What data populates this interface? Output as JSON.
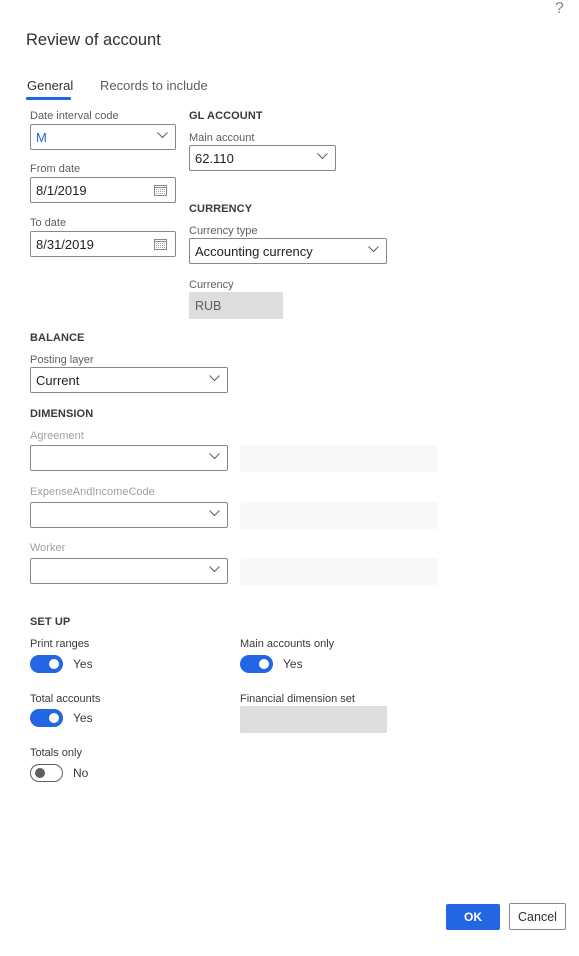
{
  "dialog": {
    "title": "Review of account",
    "help_icon": "question-mark-icon",
    "help_glyph": "?"
  },
  "tabs": [
    {
      "label": "General",
      "active": true
    },
    {
      "label": "Records to include",
      "active": false
    }
  ],
  "general": {
    "date_interval_code": {
      "label": "Date interval code",
      "value": "M"
    },
    "from_date": {
      "label": "From date",
      "value": "8/1/2019"
    },
    "to_date": {
      "label": "To date",
      "value": "8/31/2019"
    },
    "gl_account": {
      "heading": "GL ACCOUNT",
      "main_account": {
        "label": "Main account",
        "value": "62.110"
      }
    },
    "currency": {
      "heading": "CURRENCY",
      "currency_type": {
        "label": "Currency type",
        "value": "Accounting currency"
      },
      "currency": {
        "label": "Currency",
        "value": "RUB"
      }
    },
    "balance": {
      "heading": "BALANCE",
      "posting_layer": {
        "label": "Posting layer",
        "value": "Current"
      }
    },
    "dimension": {
      "heading": "DIMENSION",
      "fields": [
        {
          "label": "Agreement",
          "value": "",
          "description": ""
        },
        {
          "label": "ExpenseAndIncomeCode",
          "value": "",
          "description": ""
        },
        {
          "label": "Worker",
          "value": "",
          "description": ""
        }
      ]
    },
    "setup": {
      "heading": "SET UP",
      "print_ranges": {
        "label": "Print ranges",
        "on": true,
        "text": "Yes"
      },
      "main_accounts_only": {
        "label": "Main accounts only",
        "on": true,
        "text": "Yes"
      },
      "total_accounts": {
        "label": "Total accounts",
        "on": true,
        "text": "Yes"
      },
      "financial_dimension_set": {
        "label": "Financial dimension set",
        "value": ""
      },
      "totals_only": {
        "label": "Totals only",
        "on": false,
        "text": "No"
      }
    }
  },
  "footer": {
    "ok_label": "OK",
    "cancel_label": "Cancel"
  },
  "colors": {
    "accent": "#2266e3",
    "readonly_bg": "#dddddd",
    "border": "#8a8886"
  }
}
